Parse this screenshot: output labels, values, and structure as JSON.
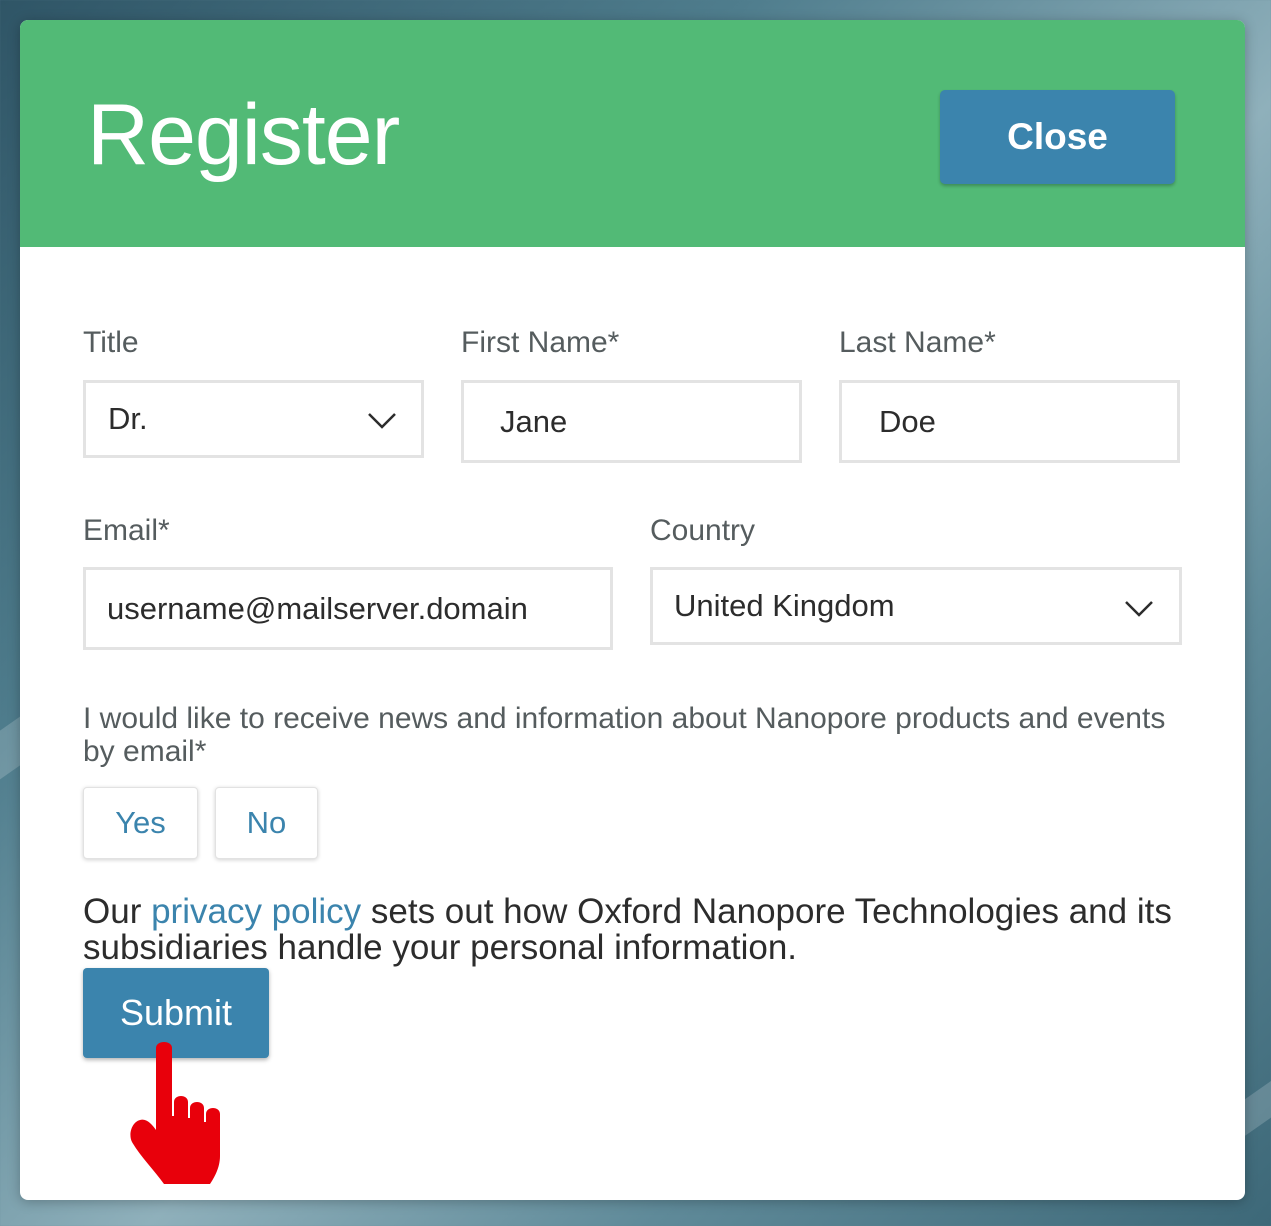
{
  "dialog": {
    "title": "Register",
    "close_label": "Close"
  },
  "form": {
    "title_field": {
      "label": "Title",
      "value": "Dr."
    },
    "first_name": {
      "label": "First Name*",
      "value": "Jane"
    },
    "last_name": {
      "label": "Last Name*",
      "value": "Doe"
    },
    "email": {
      "label": "Email*",
      "value": "username@mailserver.domain"
    },
    "country": {
      "label": "Country",
      "value": "United Kingdom"
    },
    "consent": {
      "question": "I would like to receive news and information about Nanopore products and events by email*",
      "yes_label": "Yes",
      "no_label": "No"
    },
    "privacy": {
      "prefix": "Our ",
      "link_text": "privacy policy",
      "suffix": " sets out how Oxford Nanopore Technologies and its subsidiaries handle your personal information."
    },
    "submit_label": "Submit"
  },
  "colors": {
    "header": "#52ba76",
    "primary_button": "#3b84ad",
    "link": "#3b84ad",
    "pointer_cursor": "#e8000b"
  },
  "icons": {
    "dropdown": "chevron-down-icon",
    "cursor": "hand-pointer-cursor-icon"
  }
}
